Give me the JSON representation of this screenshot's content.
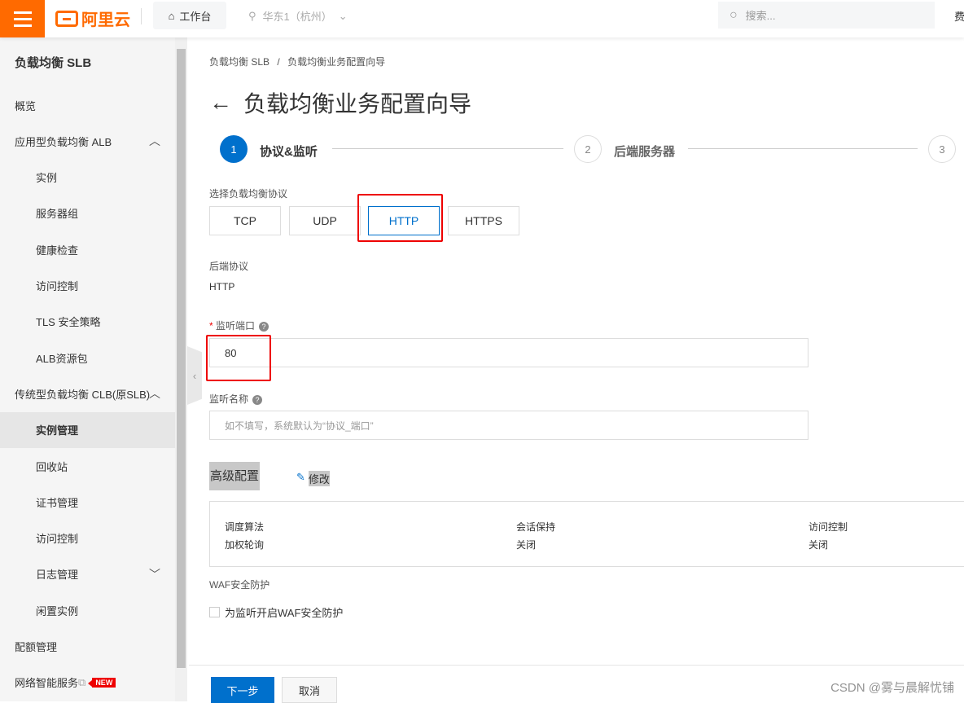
{
  "topbar": {
    "logo": "阿里云",
    "workbench": "工作台",
    "region": "华东1（杭州）",
    "search_placeholder": "搜索...",
    "fee": "费"
  },
  "sidebar": {
    "title": "负载均衡 SLB",
    "items": [
      {
        "label": "概览",
        "level": 1
      },
      {
        "label": "应用型负载均衡 ALB",
        "level": 1,
        "chevron": "up"
      },
      {
        "label": "实例",
        "level": 2
      },
      {
        "label": "服务器组",
        "level": 2
      },
      {
        "label": "健康检查",
        "level": 2
      },
      {
        "label": "访问控制",
        "level": 2
      },
      {
        "label": "TLS 安全策略",
        "level": 2
      },
      {
        "label": "ALB资源包",
        "level": 2
      },
      {
        "label": "传统型负载均衡 CLB(原SLB)",
        "level": 1,
        "chevron": "up"
      },
      {
        "label": "实例管理",
        "level": 2,
        "active": true
      },
      {
        "label": "回收站",
        "level": 2
      },
      {
        "label": "证书管理",
        "level": 2
      },
      {
        "label": "访问控制",
        "level": 2
      },
      {
        "label": "日志管理",
        "level": 2,
        "chevron": "down"
      },
      {
        "label": "闲置实例",
        "level": 2
      },
      {
        "label": "配额管理",
        "level": 1
      },
      {
        "label": "网络智能服务",
        "level": 1,
        "badge": "NEW"
      }
    ]
  },
  "breadcrumb": {
    "root": "负载均衡 SLB",
    "sep": "/",
    "current": "负载均衡业务配置向导"
  },
  "page_title": "负载均衡业务配置向导",
  "steps": [
    {
      "num": "1",
      "label": "协议&监听",
      "active": true
    },
    {
      "num": "2",
      "label": "后端服务器"
    },
    {
      "num": "3",
      "label": ""
    }
  ],
  "protocol": {
    "label": "选择负载均衡协议",
    "options": [
      "TCP",
      "UDP",
      "HTTP",
      "HTTPS"
    ],
    "selected": "HTTP"
  },
  "backend": {
    "label": "后端协议",
    "value": "HTTP"
  },
  "port": {
    "required": "*",
    "label": "监听端口",
    "value": "80"
  },
  "name": {
    "label": "监听名称",
    "placeholder": "如不填写，系统默认为“协议_端口”"
  },
  "advanced": {
    "title": "高级配置",
    "edit": "修改",
    "fields": [
      {
        "k": "调度算法",
        "v": "加权轮询"
      },
      {
        "k": "会话保持",
        "v": "关闭"
      },
      {
        "k": "访问控制",
        "v": "关闭"
      }
    ]
  },
  "waf": {
    "label": "WAF安全防护",
    "checkbox": "为监听开启WAF安全防护",
    "checked": false
  },
  "footer": {
    "next": "下一步",
    "cancel": "取消"
  },
  "watermark": "CSDN @雾与晨解忧铺",
  "colors": {
    "brand": "#ff6a00",
    "primary": "#0070cc",
    "highlight": "#e00000"
  }
}
